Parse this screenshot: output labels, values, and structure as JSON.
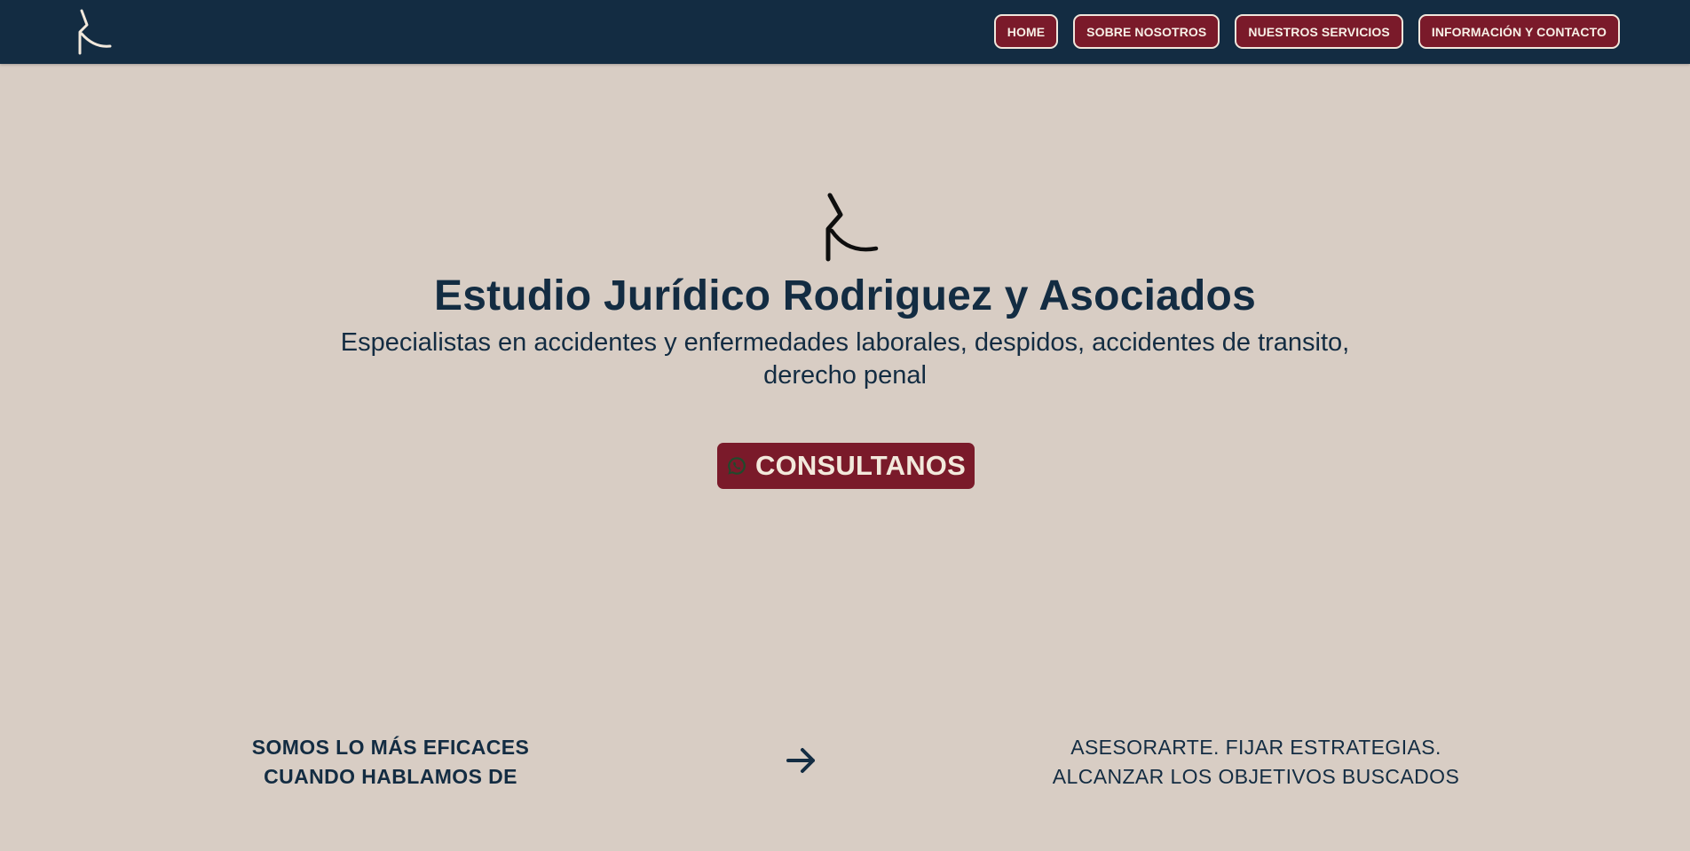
{
  "nav": {
    "logo": "rodriguez-monogram-logo",
    "items": [
      {
        "label": "HOME"
      },
      {
        "label": "SOBRE NOSOTROS"
      },
      {
        "label": "NUESTROS SERVICIOS"
      },
      {
        "label": "INFORMACIÓN Y CONTACTO"
      }
    ]
  },
  "hero": {
    "logo": "rodriguez-monogram-logo",
    "title": "Estudio Jurídico Rodriguez y Asociados",
    "subtitle_line1": "Especialistas en accidentes y enfermedades laborales, despidos, accidentes de transito,",
    "subtitle_line2": "derecho penal",
    "cta_icon": "whatsapp-icon",
    "cta_label": "CONSULTANOS"
  },
  "bottom": {
    "left_line1": "SOMOS LO MÁS EFICACES",
    "left_line2": "CUANDO HABLAMOS DE",
    "arrow_icon": "arrow-right-icon",
    "right_line1": "ASESORARTE. FIJAR ESTRATEGIAS.",
    "right_line2": "ALCANZAR LOS OBJETIVOS BUSCADOS"
  },
  "colors": {
    "navy": "#132c42",
    "burgundy": "#7a1a2a",
    "background": "#d8cdc4",
    "cream": "#f2e9dc"
  }
}
